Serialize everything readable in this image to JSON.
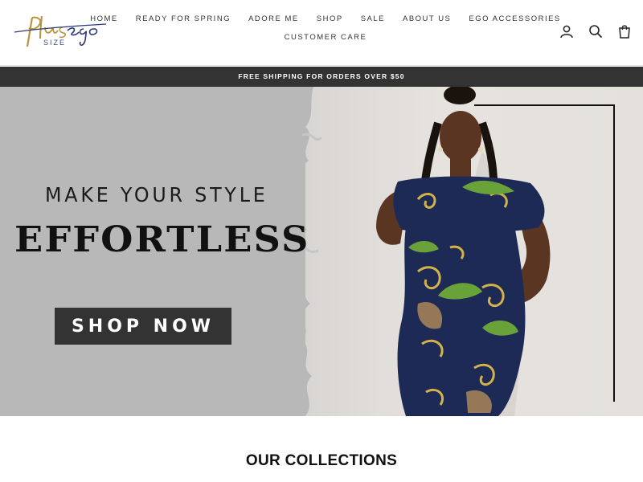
{
  "brand": {
    "logo_script": "Plus Ego",
    "logo_size_text": "SIZE",
    "colors": {
      "gold": "#b8953a",
      "navy": "#2e3a7a"
    }
  },
  "nav": {
    "row1": [
      "HOME",
      "READY FOR SPRING",
      "ADORE ME",
      "SHOP",
      "SALE",
      "ABOUT US",
      "EGO ACCESSORIES"
    ],
    "row2": [
      "CUSTOMER CARE"
    ]
  },
  "header_icons": [
    "account-icon",
    "search-icon",
    "cart-icon"
  ],
  "announcement": "FREE SHIPPING FOR ORDERS OVER $50",
  "hero": {
    "subtitle": "MAKE YOUR STYLE",
    "title": "EFFORTLESS",
    "cta": "SHOP NOW",
    "colors": {
      "left_bg": "#b8b8b8",
      "button": "#333333"
    }
  },
  "collections": {
    "title": "OUR COLLECTIONS"
  }
}
